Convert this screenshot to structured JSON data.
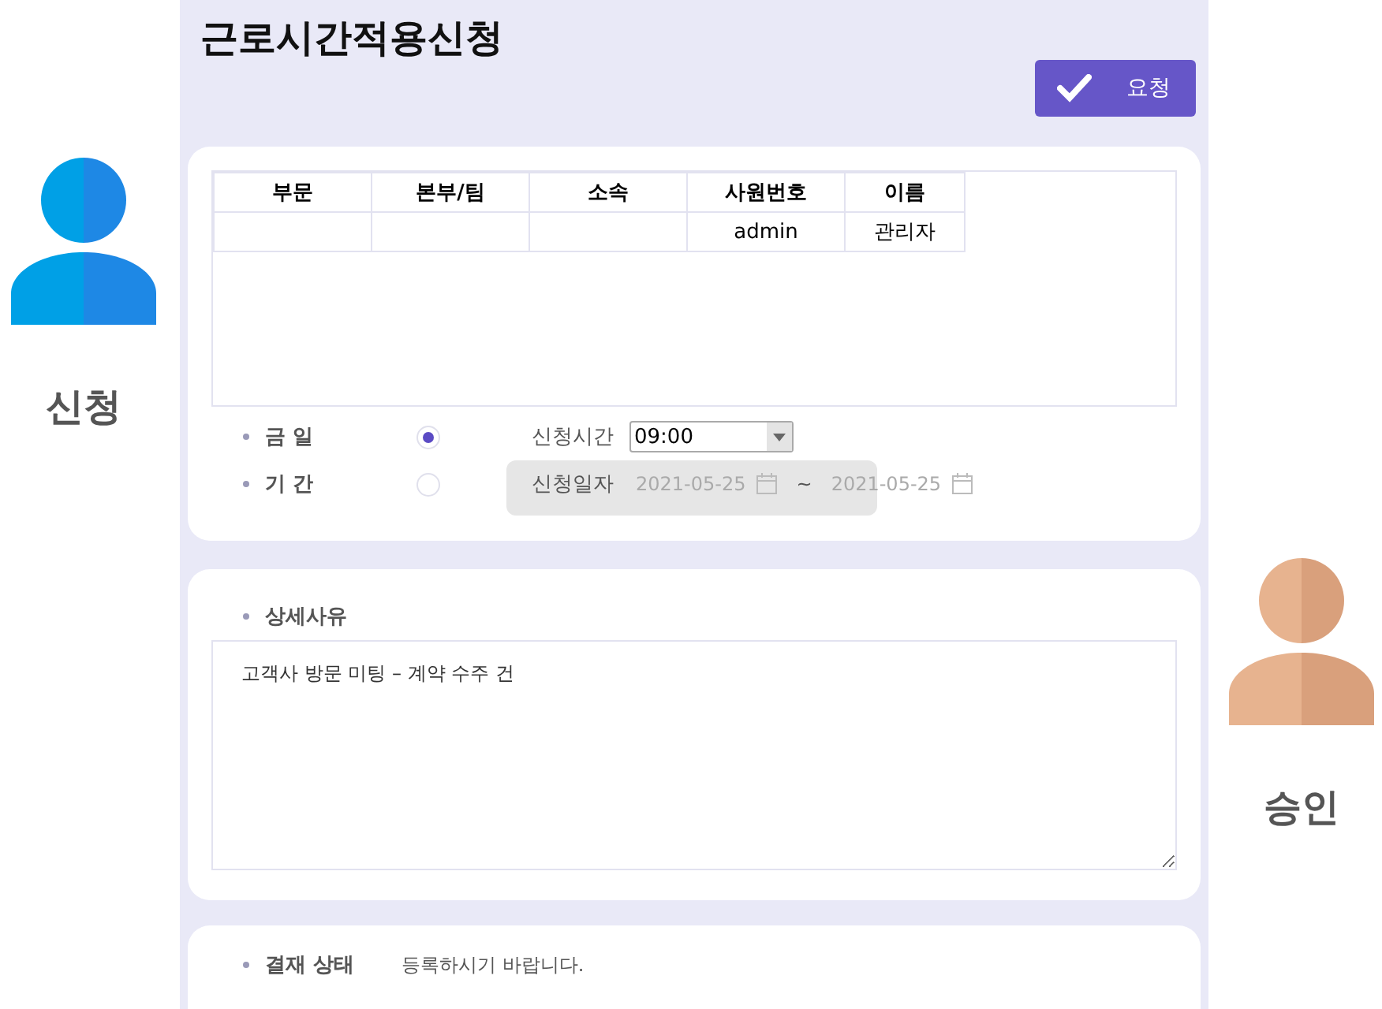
{
  "title": "근로시간적용신청",
  "request_button": {
    "label": "요청"
  },
  "applicant": {
    "label": "신청"
  },
  "approver": {
    "label": "승인"
  },
  "table": {
    "columns": [
      "부문",
      "본부/팀",
      "소속",
      "사원번호",
      "이름"
    ],
    "rows": [
      {
        "cells": [
          null,
          null,
          null,
          "admin",
          "관리자"
        ]
      }
    ]
  },
  "options": [
    {
      "label": "금 일",
      "selected": true,
      "kind": "time",
      "field_label": "신청시간",
      "value": "09:00"
    },
    {
      "label": "기 간",
      "selected": false,
      "kind": "date_range",
      "field_label": "신청일자",
      "from": "2021-05-25",
      "separator": "~",
      "to": "2021-05-25"
    }
  ],
  "detail": {
    "label": "상세사유",
    "value": "고객사 방문 미팅 – 계약 수주 건"
  },
  "status": {
    "label": "결재 상태",
    "value": "등록하시기 바랍니다."
  }
}
